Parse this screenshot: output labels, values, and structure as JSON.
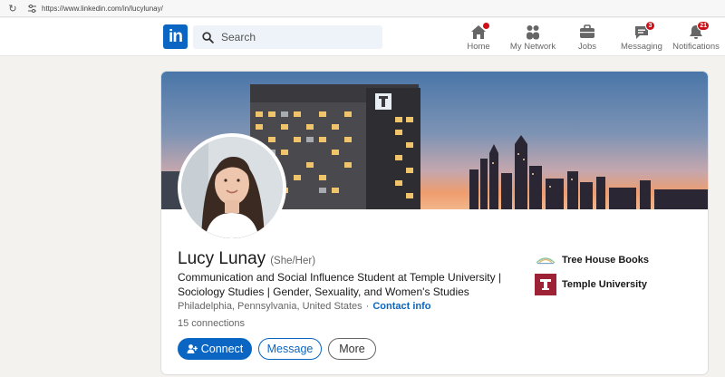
{
  "browser": {
    "url": "https://www.linkedin.com/in/lucylunay/"
  },
  "nav": {
    "logo_text": "in",
    "search_placeholder": "Search",
    "items": [
      {
        "label": "Home",
        "icon": "home-icon",
        "badge": ""
      },
      {
        "label": "My Network",
        "icon": "network-icon",
        "badge": ""
      },
      {
        "label": "Jobs",
        "icon": "briefcase-icon",
        "badge": ""
      },
      {
        "label": "Messaging",
        "icon": "messaging-icon",
        "badge": "3"
      },
      {
        "label": "Notifications",
        "icon": "bell-icon",
        "badge": "21"
      }
    ]
  },
  "profile": {
    "name": "Lucy Lunay",
    "pronouns": "(She/Her)",
    "headline": "Communication and Social Influence Student at Temple University | Sociology Studies | Gender, Sexuality, and Women's Studies",
    "location": "Philadelphia, Pennsylvania, United States",
    "separator": "·",
    "contact_info": "Contact info",
    "connections": "15 connections",
    "actions": {
      "connect": "Connect",
      "message": "Message",
      "more": "More"
    },
    "organizations": [
      {
        "name": "Tree House Books",
        "logo_text": "TreeHouse"
      },
      {
        "name": "Temple University",
        "logo_text": "T"
      }
    ]
  },
  "colors": {
    "brand": "#0a66c2",
    "badge": "#cc1016",
    "temple_red": "#9d2235"
  }
}
